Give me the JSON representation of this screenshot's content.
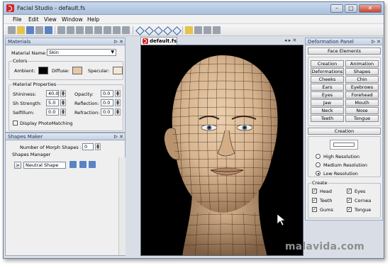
{
  "window": {
    "title": "Facial Studio - default.fs",
    "controls": {
      "minimize": "–",
      "maximize": "□",
      "close": "✕"
    }
  },
  "menu": {
    "items": [
      "File",
      "Edit",
      "View",
      "Window",
      "Help"
    ]
  },
  "materials": {
    "header": "Materials",
    "material_name_label": "Material Name:",
    "material_name_value": "Skin",
    "colors_group": "Colors",
    "ambient_label": "Ambient:",
    "diffuse_label": "Diffuse:",
    "specular_label": "Specular:",
    "ambient_color": "#000000",
    "diffuse_color": "#e8c6a8",
    "specular_color": "#f5e6d6",
    "properties_group": "Material Properties",
    "shininess_label": "Shininess:",
    "shininess_value": "40.0",
    "strength_label": "Sh Strength:",
    "strength_value": "5.0",
    "selfillum_label": "Selfillum:",
    "selfillum_value": "0.0",
    "opacity_label": "Opacity:",
    "opacity_value": "0.0",
    "reflection_label": "Reflection:",
    "reflection_value": "0.0",
    "refraction_label": "Refraction:",
    "refraction_value": "0.0",
    "display_photo_label": "Display PhotoMatching"
  },
  "shapes": {
    "header": "Shapes Maker",
    "morph_label": "Number of Morph Shapes :",
    "morph_value": "0",
    "manager_label": "Shapes Manager",
    "neutral_label": "Neutral Shape"
  },
  "document": {
    "tab_label": "default.fs"
  },
  "deformation": {
    "header": "Deformation Panel",
    "face_elements_button": "Face Elements",
    "buttons": [
      [
        "Creation",
        "Animation"
      ],
      [
        "Deformations",
        "Shapes"
      ],
      [
        "Cheeks",
        "Chin"
      ],
      [
        "Ears",
        "Eyebrows"
      ],
      [
        "Eyes",
        "Forehead"
      ],
      [
        "Jaw",
        "Mouth"
      ],
      [
        "Neck",
        "Nose"
      ],
      [
        "Teeth",
        "Tongue"
      ]
    ],
    "creation_button": "Creation",
    "resolution": [
      "High Resolution",
      "Medium Resolution",
      "Low Resolution"
    ],
    "selected_resolution": "Low Resolution",
    "create_group": "Create",
    "create_items": [
      [
        "Head",
        "Eyes"
      ],
      [
        "Teeth",
        "Cornea"
      ],
      [
        "Gums",
        "Tongue"
      ]
    ]
  },
  "watermark": "malavida.com",
  "colors": {
    "skin": "#e3c29f",
    "skin_shadow": "#9c7a5a",
    "mesh": "#2a1c12",
    "accent_red": "#d1262b"
  }
}
